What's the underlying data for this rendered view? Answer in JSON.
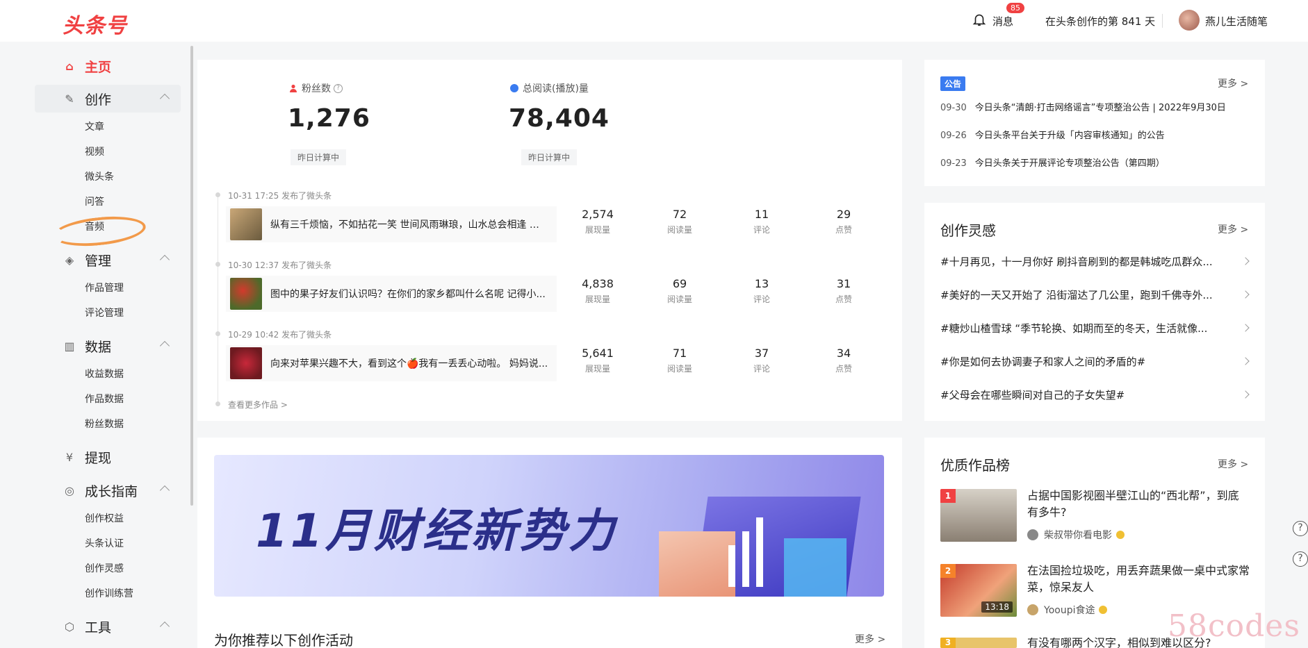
{
  "header": {
    "logo": "头条号",
    "badge_count": "85",
    "messages_label": "消息",
    "days_text": "在头条创作的第 841 天",
    "username": "燕儿生活随笔"
  },
  "sidebar": {
    "home": "主页",
    "create": "创作",
    "create_items": [
      "文章",
      "视频",
      "微头条",
      "问答",
      "音频"
    ],
    "manage": "管理",
    "manage_items": [
      "作品管理",
      "评论管理"
    ],
    "data": "数据",
    "data_items": [
      "收益数据",
      "作品数据",
      "粉丝数据"
    ],
    "withdraw": "提现",
    "growth": "成长指南",
    "growth_items": [
      "创作权益",
      "头条认证",
      "创作灵感",
      "创作训练营"
    ],
    "tools": "工具"
  },
  "stats": {
    "fans_label": "粉丝数",
    "fans_value": "1,276",
    "fans_tag": "昨日计算中",
    "reads_label": "总阅读(播放)量",
    "reads_value": "78,404",
    "reads_tag": "昨日计算中"
  },
  "posts": [
    {
      "meta": "10-31 17:25  发布了微头条",
      "text": "纵有三千烦恼，不如拈花一笑 世间风雨琳琅，山水总会相逢 百...",
      "impressions": "2,574",
      "reads": "72",
      "comments": "11",
      "likes": "29"
    },
    {
      "meta": "10-30 12:37  发布了微头条",
      "text": "图中的果子好友们认识吗？在你们的家乡都叫什么名呢 记得小...",
      "impressions": "4,838",
      "reads": "69",
      "comments": "13",
      "likes": "31"
    },
    {
      "meta": "10-29 10:42  发布了微头条",
      "text": "向来对苹果兴趣不大，看到这个🍎我有一丢丢心动啦。 妈妈说...",
      "impressions": "5,641",
      "reads": "71",
      "comments": "37",
      "likes": "34"
    }
  ],
  "metric_labels": {
    "impressions": "展现量",
    "reads": "阅读量",
    "comments": "评论",
    "likes": "点赞"
  },
  "see_more_works": "查看更多作品 >",
  "banner_text": "11月财经新势力",
  "recommend_title": "为你推荐以下创作活动",
  "more_label": "更多 >",
  "notice": {
    "tag": "公告",
    "more": "更多 >",
    "items": [
      {
        "date": "09-30",
        "text": "今日头条“清朗·打击网络谣言”专项整治公告 | 2022年9月30日"
      },
      {
        "date": "09-26",
        "text": "今日头条平台关于升级「内容审核通知」的公告"
      },
      {
        "date": "09-23",
        "text": "今日头条关于开展评论专项整治公告（第四期）"
      }
    ]
  },
  "inspiration": {
    "title": "创作灵感",
    "more": "更多 >",
    "items": [
      "#十月再见，十一月你好 刷抖音刷到的都是韩城吃瓜群众...",
      "#美好的一天又开始了 沿街溜达了几公里，跑到千佛寺外...",
      "#糖炒山楂雪球 “季节轮换、如期而至的冬天，生活就像...",
      "#你是如何去协调妻子和家人之间的矛盾的#",
      "#父母会在哪些瞬间对自己的子女失望#"
    ]
  },
  "ranking": {
    "title": "优质作品榜",
    "more": "更多 >",
    "items": [
      {
        "num": "1",
        "title": "占据中国影视圈半壁江山的“西北帮”，到底有多牛?",
        "author": "柴叔带你看电影"
      },
      {
        "num": "2",
        "title": "在法国捡垃圾吃，用丢弃蔬果做一桌中式家常菜，惊呆友人",
        "author": "Yooupi食途",
        "duration": "13:18"
      },
      {
        "num": "3",
        "title": "有没有哪两个汉字，相似到难以区分?",
        "author": ""
      }
    ]
  },
  "floats": [
    "?",
    "?"
  ],
  "watermark": "58codes",
  "colors": {
    "brand": "#f04142",
    "accent": "#3a7bf0",
    "annotation": "#f29a4a"
  }
}
